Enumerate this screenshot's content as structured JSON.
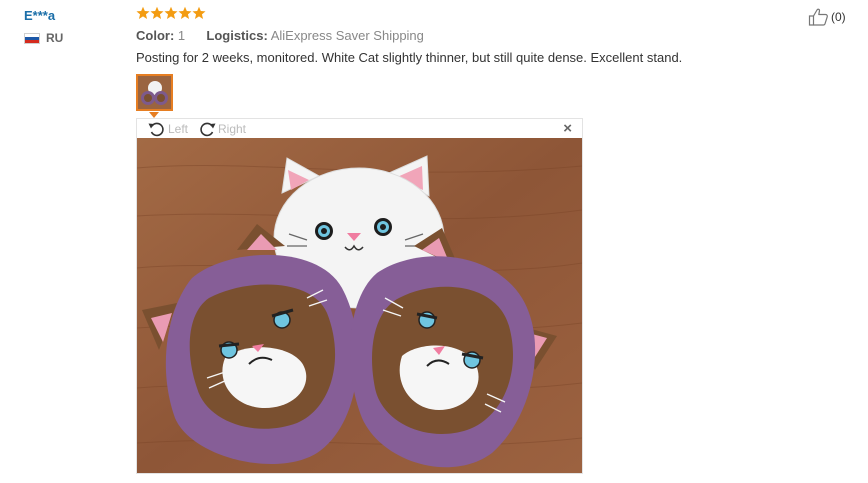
{
  "reviewer": {
    "name": "E***a",
    "country": "RU",
    "flag_icon": "russia-flag-icon"
  },
  "rating": {
    "stars": 5,
    "max": 5,
    "color": "#f39c12"
  },
  "meta": {
    "color_label": "Color:",
    "color_value": "1",
    "logistics_label": "Logistics:",
    "logistics_value": "AliExpress Saver Shipping"
  },
  "review_text": "Posting for 2 weeks, monitored. White Cat slightly thinner, but still quite dense. Excellent stand.",
  "helpful": {
    "icon": "thumbs-up-icon",
    "count": "(0)"
  },
  "viewer": {
    "rotate_left_label": "Left",
    "rotate_right_label": "Right",
    "close_label": "×"
  },
  "colors": {
    "link": "#1a6ea8",
    "accent": "#e67e22",
    "star": "#f39c12"
  }
}
